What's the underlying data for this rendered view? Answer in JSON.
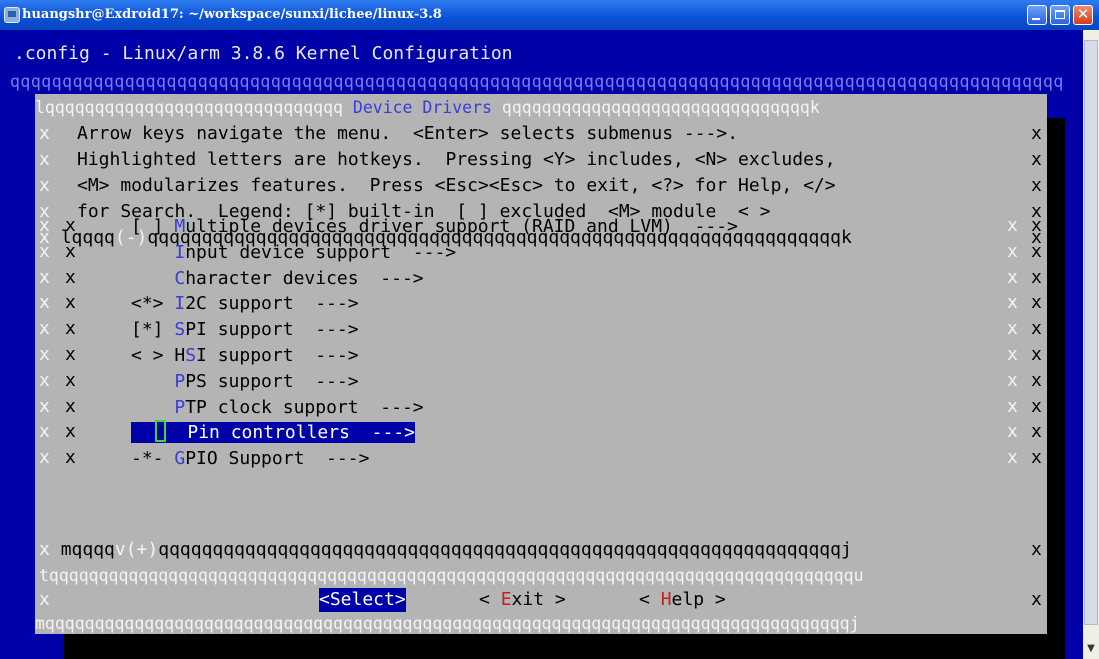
{
  "window": {
    "title": "huangshr@Exdroid17: ~/workspace/sunxi/lichee/linux-3.8",
    "minimize_label": "",
    "close_label": "✕"
  },
  "header": {
    "config_title": ".config - Linux/arm 3.8.6 Kernel Configuration",
    "separator": "qqqqqqqqqqqqqqqqqqqqqqqqqqqqqqqqqqqqqqqqqqqqqqqqqqqqqqqqqqqqqqqqqqqqqqqqqqqqqqqqqqqqqqqqqqqqqqqqqqqqq"
  },
  "dialog": {
    "top_left": "lqqqqqqqqqqqqqqqqqqqqqqqqqqqqqq ",
    "title": "Device Drivers",
    "top_right": " qqqqqqqqqqqqqqqqqqqqqqqqqqqqqqqk",
    "help_lines": [
      "Arrow keys navigate the menu.  <Enter> selects submenus --->.",
      "Highlighted letters are hotkeys.  Pressing <Y> includes, <N> excludes,",
      "<M> modularizes features.  Press <Esc><Esc> to exit, <?> for Help, </>",
      "for Search.  Legend: [*] built-in  [ ] excluded  <M> module  < >"
    ],
    "inner_top_left": "lqqqq",
    "inner_top_marker": "(-)",
    "inner_top_rest": "qqqqqqqqqqqqqqqqqqqqqqqqqqqqqqqqqqqqqqqqqqqqqqqqqqqqqqqqqqqqqqqqk",
    "inner_bottom_left": "mqqqq",
    "inner_bottom_marker": "v(+)",
    "inner_bottom_rest": "qqqqqqqqqqqqqqqqqqqqqqqqqqqqqqqqqqqqqqqqqqqqqqqqqqqqqqqqqqqqqqqj",
    "sep_line": "tqqqqqqqqqqqqqqqqqqqqqqqqqqqqqqqqqqqqqqqqqqqqqqqqqqqqqqqqqqqqqqqqqqqqqqqqqqqqqqqqqu",
    "bottom_line": "mqqqqqqqqqqqqqqqqqqqqqqqqqqqqqqqqqqqqqqqqqqqqqqqqqqqqqqqqqqqqqqqqqqqqqqqqqqqqqqqqqj",
    "border_char": "x"
  },
  "menu": {
    "items": [
      {
        "prefix": "[ ] ",
        "hot": "M",
        "rest": "ultiple devices driver support (RAID and LVM)  --->"
      },
      {
        "prefix": "    ",
        "hot": "I",
        "rest": "nput device support  --->"
      },
      {
        "prefix": "    ",
        "hot": "C",
        "rest": "haracter devices  --->"
      },
      {
        "prefix": "<*> ",
        "hot": "I",
        "rest": "2C support  --->"
      },
      {
        "prefix": "[*] ",
        "hot": "S",
        "rest": "PI support  --->"
      },
      {
        "prefix": "< > H",
        "hot": "S",
        "rest": "I support  --->"
      },
      {
        "prefix": "    ",
        "hot": "P",
        "rest": "PS support  --->"
      },
      {
        "prefix": "    ",
        "hot": "P",
        "rest": "TP clock support  --->"
      },
      {
        "prefix": "    ",
        "hot": "",
        "rest": "Pin controllers  --->"
      },
      {
        "prefix": "-*- ",
        "hot": "G",
        "rest": "PIO Support  --->"
      }
    ]
  },
  "buttons": {
    "select": "<Select>",
    "exit_pre": "< ",
    "exit_hot": "E",
    "exit_rest": "xit >",
    "help_pre": "< ",
    "help_hot": "H",
    "help_rest": "elp >"
  },
  "colors": {
    "terminal_bg": "#0000a8",
    "dialog_bg": "#b4b4b4",
    "hotkey": "#3b3bd8",
    "cursor": "#38d838"
  }
}
